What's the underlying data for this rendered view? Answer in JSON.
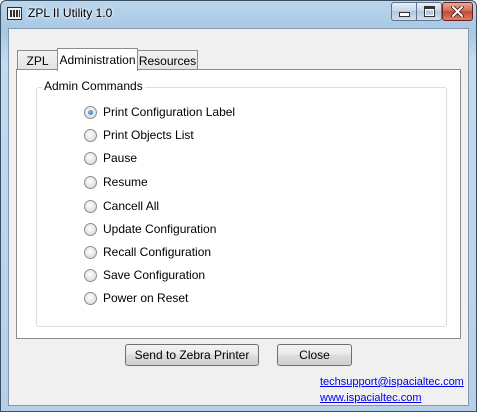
{
  "window": {
    "title": "ZPL II Utility 1.0",
    "controls": {
      "minimize_glyph": "–",
      "maximize_glyph": "□",
      "close_glyph": "✕"
    }
  },
  "tabs": [
    {
      "label": "ZPL",
      "active": false
    },
    {
      "label": "Administration",
      "active": true
    },
    {
      "label": "Resources",
      "active": false
    }
  ],
  "admin_commands": {
    "legend": "Admin Commands",
    "options": [
      {
        "label": "Print Configuration Label",
        "checked": true
      },
      {
        "label": "Print Objects List",
        "checked": false
      },
      {
        "label": "Pause",
        "checked": false
      },
      {
        "label": "Resume",
        "checked": false
      },
      {
        "label": "Cancell All",
        "checked": false
      },
      {
        "label": "Update Configuration",
        "checked": false
      },
      {
        "label": "Recall Configuration",
        "checked": false
      },
      {
        "label": "Save Configuration",
        "checked": false
      },
      {
        "label": "Power on Reset",
        "checked": false
      }
    ]
  },
  "buttons": {
    "send_label": "Send to Zebra Printer",
    "close_label": "Close"
  },
  "links": {
    "email": "techsupport@ispacialtec.com",
    "website": "www.ispacialtec.com"
  },
  "colors": {
    "title_bar": "#a7c7e3",
    "close_button": "#c24a33",
    "link": "#0000ee"
  }
}
